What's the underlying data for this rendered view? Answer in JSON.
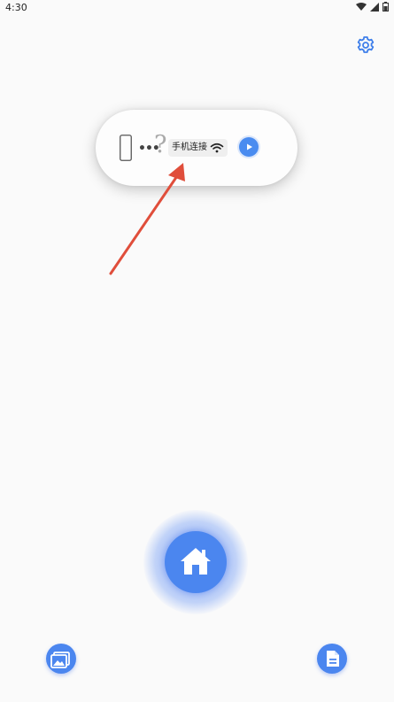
{
  "status_bar": {
    "time": "4:30",
    "icons": [
      "wifi-icon",
      "signal-icon",
      "battery-icon"
    ]
  },
  "header": {
    "settings_icon": "gear-icon"
  },
  "connection_widget": {
    "phone_icon": "phone-outline-icon",
    "dots": "•••",
    "question_mark": "?",
    "chip_label": "手机连接",
    "chip_icon": "wifi-icon",
    "play_icon": "play-icon"
  },
  "annotation": {
    "type": "red-arrow",
    "color": "#e04e3b"
  },
  "home_button": {
    "icon": "home-icon"
  },
  "bottom_bar": {
    "left_icon": "image-gallery-icon",
    "right_icon": "document-icon"
  },
  "colors": {
    "accent": "#4b86ef",
    "background": "#fafafa",
    "arrow": "#e04e3b"
  }
}
